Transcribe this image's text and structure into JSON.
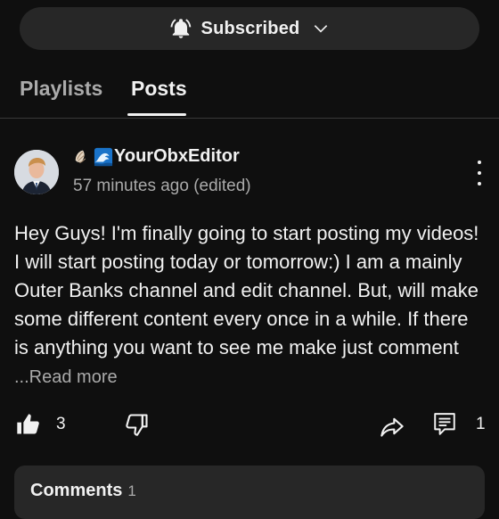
{
  "subscribe": {
    "label": "Subscribed",
    "icon": "bell-ringing-icon",
    "chevron": "chevron-down-icon"
  },
  "tabs": [
    {
      "label": "Playlists",
      "active": false
    },
    {
      "label": "Posts",
      "active": true
    }
  ],
  "post": {
    "author": "YourObxEditor",
    "author_prefix_icons": [
      "shell-icon",
      "wave-icon"
    ],
    "timestamp": "57 minutes ago (edited)",
    "text": "Hey Guys! I'm finally going to start posting my videos! I will start posting today or tomorrow:) I am a mainly Outer Banks channel and edit channel. But, will make some different content every once in a while. If there is anything you want to see me make just comment",
    "read_more": "...Read more",
    "likes": "3",
    "comments": "1"
  },
  "comments_section": {
    "title": "Comments",
    "count": "1"
  },
  "colors": {
    "background": "#0f0f0f",
    "surface": "#272727",
    "text": "#f1f1f1",
    "muted": "#aaaaaa"
  }
}
